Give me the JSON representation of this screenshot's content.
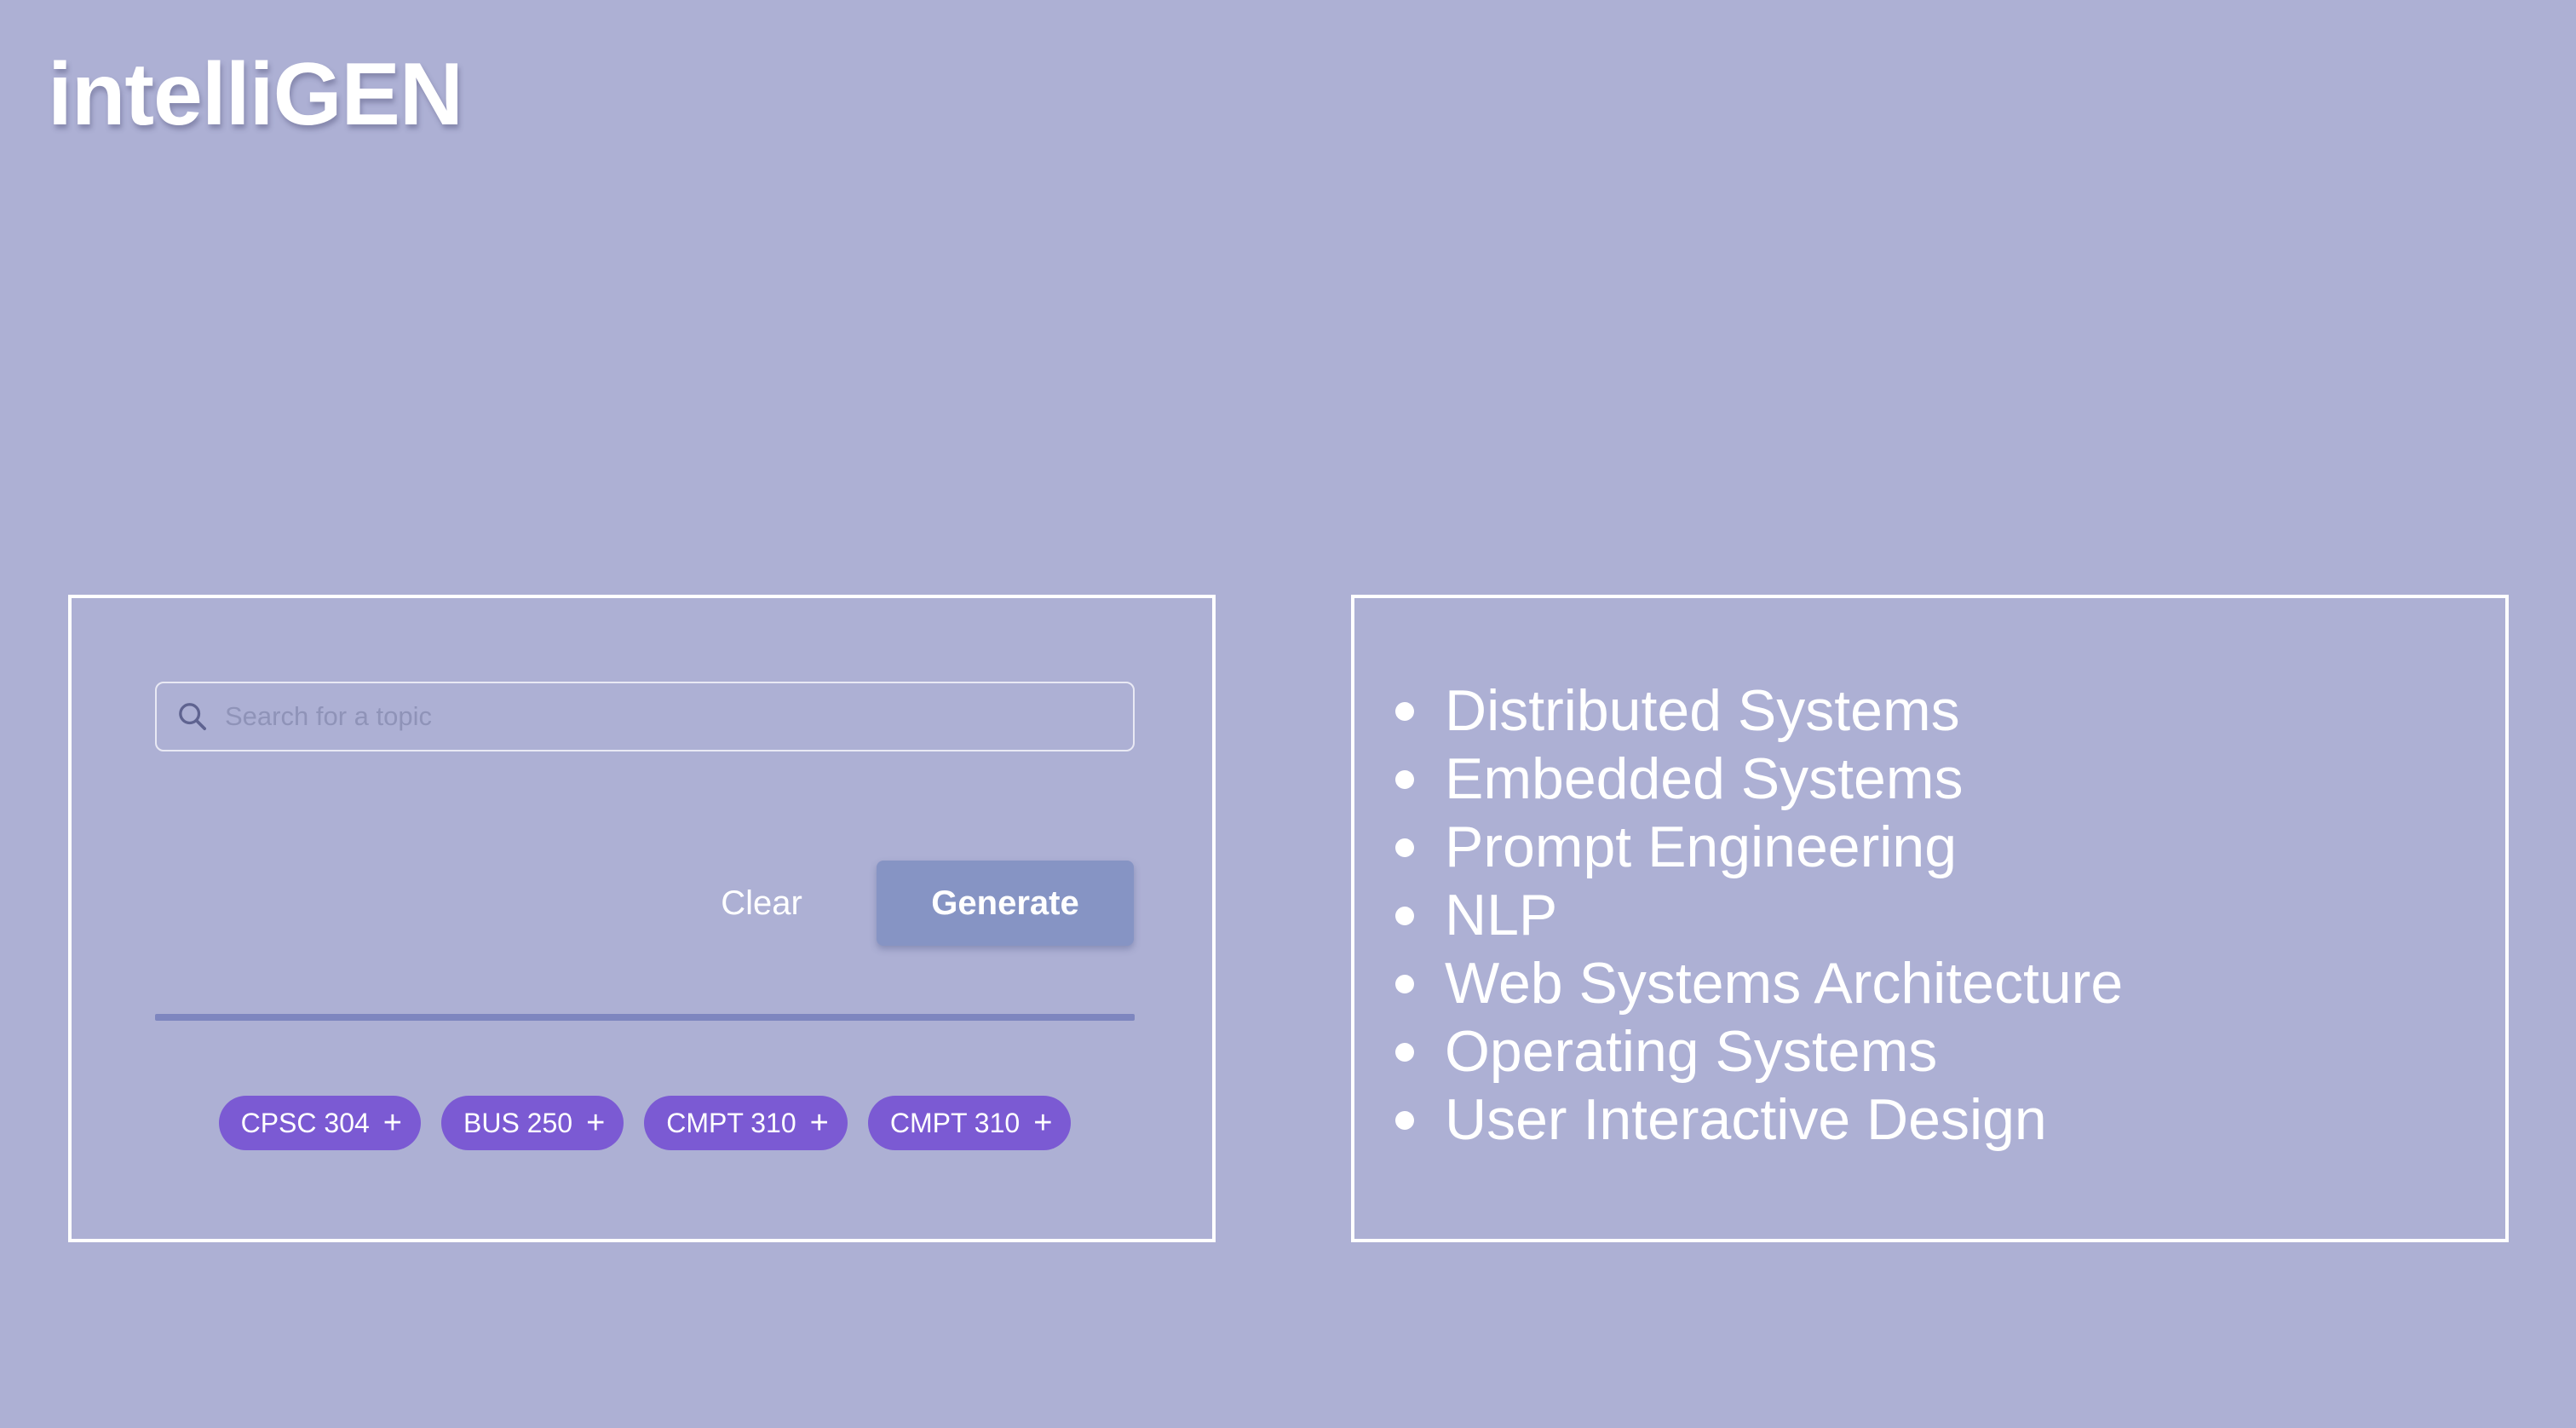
{
  "app": {
    "title": "intelliGEN"
  },
  "search": {
    "placeholder": "Search for a topic",
    "value": ""
  },
  "actions": {
    "clear_label": "Clear",
    "generate_label": "Generate"
  },
  "progress": {
    "percent": 100
  },
  "chips": [
    {
      "label": "CPSC 304",
      "icon": "plus-icon"
    },
    {
      "label": "BUS 250",
      "icon": "plus-icon"
    },
    {
      "label": "CMPT 310",
      "icon": "plus-icon"
    },
    {
      "label": "CMPT 310",
      "icon": "plus-icon"
    }
  ],
  "topics": [
    "Distributed Systems",
    "Embedded Systems",
    "Prompt Engineering",
    "NLP",
    "Web Systems Architecture",
    "Operating Systems",
    "User Interactive Design"
  ],
  "colors": {
    "background": "#adb0d4",
    "chip": "#7b5ad3",
    "generate_button": "#8694c4",
    "progress_fill": "#7e86bf",
    "text": "#ffffff"
  }
}
